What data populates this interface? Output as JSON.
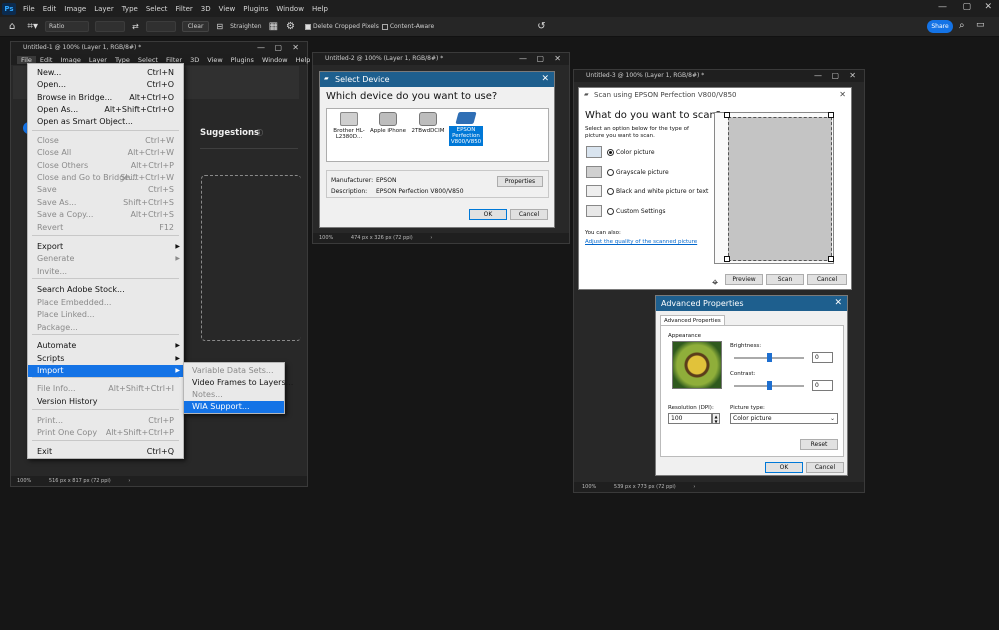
{
  "app": {
    "menu": [
      "File",
      "Edit",
      "Image",
      "Layer",
      "Type",
      "Select",
      "Filter",
      "3D",
      "View",
      "Plugins",
      "Window",
      "Help"
    ],
    "share_label": "Share",
    "logo": "Ps"
  },
  "options_bar": {
    "ratio_label": "Ratio",
    "clear_label": "Clear",
    "straighten_label": "Straighten",
    "delete_cropped_label": "Delete Cropped Pixels",
    "content_aware_label": "Content-Aware"
  },
  "doc1": {
    "title": "Untitled-1 @ 100% (Layer 1, RGB/8#) *",
    "menu": [
      "File",
      "Edit",
      "Image",
      "Layer",
      "Type",
      "Select",
      "Filter",
      "3D",
      "View",
      "Plugins",
      "Window",
      "Help"
    ],
    "suggestions_label": "Suggestions",
    "zoom": "100%",
    "size": "516 px x 817 px (72 ppi)"
  },
  "file_menu": {
    "items": [
      {
        "label": "New...",
        "shortcut": "Ctrl+N",
        "disabled": false
      },
      {
        "label": "Open...",
        "shortcut": "Ctrl+O",
        "disabled": false
      },
      {
        "label": "Browse in Bridge...",
        "shortcut": "Alt+Ctrl+O",
        "disabled": false
      },
      {
        "label": "Open As...",
        "shortcut": "Alt+Shift+Ctrl+O",
        "disabled": false
      },
      {
        "label": "Open as Smart Object...",
        "shortcut": "",
        "disabled": false
      },
      {
        "label": "Close",
        "shortcut": "Ctrl+W",
        "disabled": true
      },
      {
        "label": "Close All",
        "shortcut": "Alt+Ctrl+W",
        "disabled": true
      },
      {
        "label": "Close Others",
        "shortcut": "Alt+Ctrl+P",
        "disabled": true
      },
      {
        "label": "Close and Go to Bridge...",
        "shortcut": "Shift+Ctrl+W",
        "disabled": true
      },
      {
        "label": "Save",
        "shortcut": "Ctrl+S",
        "disabled": true
      },
      {
        "label": "Save As...",
        "shortcut": "Shift+Ctrl+S",
        "disabled": true
      },
      {
        "label": "Save a Copy...",
        "shortcut": "Alt+Ctrl+S",
        "disabled": true
      },
      {
        "label": "Revert",
        "shortcut": "F12",
        "disabled": true
      },
      {
        "label": "Export",
        "shortcut": "",
        "disabled": false
      },
      {
        "label": "Generate",
        "shortcut": "",
        "disabled": true
      },
      {
        "label": "Invite...",
        "shortcut": "",
        "disabled": true
      },
      {
        "label": "Search Adobe Stock...",
        "shortcut": "",
        "disabled": false
      },
      {
        "label": "Place Embedded...",
        "shortcut": "",
        "disabled": true
      },
      {
        "label": "Place Linked...",
        "shortcut": "",
        "disabled": true
      },
      {
        "label": "Package...",
        "shortcut": "",
        "disabled": true
      },
      {
        "label": "Automate",
        "shortcut": "",
        "disabled": false
      },
      {
        "label": "Scripts",
        "shortcut": "",
        "disabled": false
      },
      {
        "label": "Import",
        "shortcut": "",
        "disabled": false
      },
      {
        "label": "File Info...",
        "shortcut": "Alt+Shift+Ctrl+I",
        "disabled": true
      },
      {
        "label": "Version History",
        "shortcut": "",
        "disabled": false
      },
      {
        "label": "Print...",
        "shortcut": "Ctrl+P",
        "disabled": true
      },
      {
        "label": "Print One Copy",
        "shortcut": "Alt+Shift+Ctrl+P",
        "disabled": true
      },
      {
        "label": "Exit",
        "shortcut": "Ctrl+Q",
        "disabled": false
      }
    ]
  },
  "import_submenu": {
    "items": [
      {
        "label": "Variable Data Sets...",
        "disabled": true
      },
      {
        "label": "Video Frames to Layers...",
        "disabled": false
      },
      {
        "label": "Notes...",
        "disabled": true
      },
      {
        "label": "WIA Support...",
        "disabled": false
      }
    ]
  },
  "doc2": {
    "title": "Untitled-2 @ 100% (Layer 1, RGB/8#) *",
    "zoom": "100%",
    "size": "474 px x 326 px (72 ppi)"
  },
  "select_device": {
    "title": "Select Device",
    "question": "Which device do you want to use?",
    "devices": [
      "Brother HL-L2380D...",
      "Apple iPhone",
      "2TBwdDCIM",
      "EPSON Perfection V800/V850"
    ],
    "manufacturer_label": "Manufacturer:",
    "manufacturer": "EPSON",
    "description_label": "Description:",
    "description": "EPSON Perfection V800/V850",
    "properties_label": "Properties",
    "ok_label": "OK",
    "cancel_label": "Cancel"
  },
  "doc3": {
    "title": "Untitled-3 @ 100% (Layer 1, RGB/8#) *",
    "zoom": "100%",
    "size": "539 px x 773 px (72 ppi)"
  },
  "scan_dialog": {
    "title": "Scan using EPSON Perfection V800/V850",
    "heading": "What do you want to scan?",
    "instructions": "Select an option below for the type of picture you want to scan.",
    "options": [
      "Color picture",
      "Grayscale picture",
      "Black and white picture or text",
      "Custom Settings"
    ],
    "you_can_also": "You can also:",
    "adjust_link": "Adjust the quality of the scanned picture",
    "preview_label": "Preview",
    "scan_label": "Scan",
    "cancel_label": "Cancel"
  },
  "advanced": {
    "title": "Advanced Properties",
    "tab": "Advanced Properties",
    "appearance_label": "Appearance",
    "brightness_label": "Brightness:",
    "brightness_value": "0",
    "contrast_label": "Contrast:",
    "contrast_value": "0",
    "resolution_label": "Resolution (DPI):",
    "resolution_value": "100",
    "picture_type_label": "Picture type:",
    "picture_type_value": "Color picture",
    "reset_label": "Reset",
    "ok_label": "OK",
    "cancel_label": "Cancel"
  },
  "colors": {
    "accent": "#1473e6",
    "dialog_title": "#1e5f8e",
    "link": "#0066cc"
  }
}
